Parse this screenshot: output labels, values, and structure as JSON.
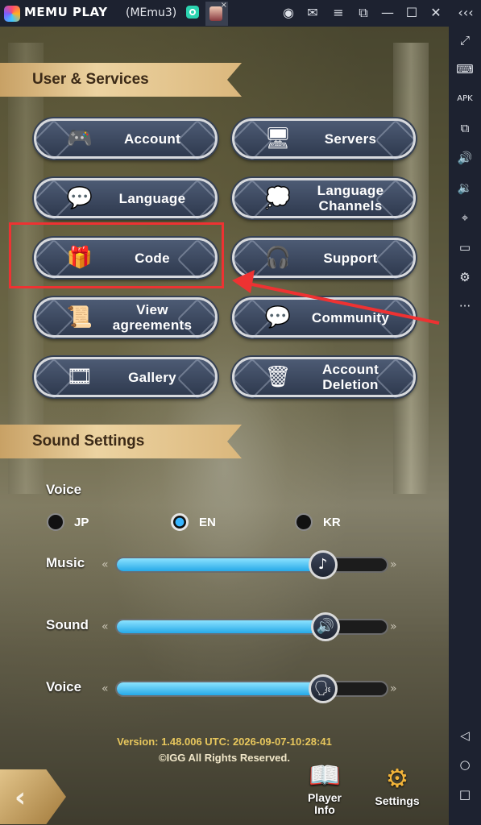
{
  "titlebar": {
    "brand": "MEMU PLAY",
    "instance": "(MEmu3)",
    "tab_close": "×",
    "icons": [
      "account-icon",
      "mail-icon",
      "menu-icon",
      "screen-icon",
      "minimize-icon",
      "maximize-icon",
      "close-icon",
      "collapse-icon"
    ],
    "glyphs": {
      "account": "◉",
      "mail": "✉",
      "menu": "≡",
      "screen": "⧉",
      "minimize": "—",
      "maximize": "☐",
      "close": "✕",
      "collapse": "‹‹‹"
    }
  },
  "sidebar": {
    "glyphs": {
      "fullscreen": "⤢",
      "keyboard": "⌨",
      "apk": "APK",
      "multi": "⧉",
      "vol_up": "🔊",
      "vol_down": "🔉",
      "location": "⌖",
      "folder": "▭",
      "settings": "⚙",
      "more": "···",
      "back": "◁",
      "home": "○",
      "recent": "□"
    }
  },
  "user_services": {
    "title": "User & Services",
    "buttons": [
      {
        "label": "Account",
        "icon": "🎮"
      },
      {
        "label": "Servers",
        "icon": "🖥"
      },
      {
        "label": "Language",
        "icon": "💬"
      },
      {
        "label": "Language Channels",
        "icon": "💭"
      },
      {
        "label": "Code",
        "icon": "🎁"
      },
      {
        "label": "Support",
        "icon": "🎧"
      },
      {
        "label": "View agreements",
        "icon": "📜"
      },
      {
        "label": "Community",
        "icon": "💬"
      },
      {
        "label": "Gallery",
        "icon": "🎞"
      },
      {
        "label": "Account Deletion",
        "icon": "🗑"
      }
    ]
  },
  "sound": {
    "title": "Sound Settings",
    "voice_heading": "Voice",
    "voice_options": [
      "JP",
      "EN",
      "KR"
    ],
    "voice_selected": "EN",
    "sliders": [
      {
        "label": "Music",
        "level": 0.76,
        "icon": "♪"
      },
      {
        "label": "Sound",
        "level": 0.77,
        "icon": "🔊"
      },
      {
        "label": "Voice",
        "level": 0.76,
        "icon": "🗣"
      }
    ],
    "chev_left": "«",
    "chev_right": "»"
  },
  "footer": {
    "version": "Version: 1.48.006  UTC: 2026-09-07-10:28:41",
    "copyright": "©IGG All Rights Reserved."
  },
  "bottom_nav": {
    "back_glyph": "‹",
    "player_info": "Player Info",
    "player_info_icon": "📖",
    "settings": "Settings",
    "settings_icon": "⚙"
  },
  "colors": {
    "highlight": "#ee3232",
    "accent": "#36b5ff",
    "ribbon": "#ecd3a1",
    "footer_text": "#e8c75d"
  }
}
